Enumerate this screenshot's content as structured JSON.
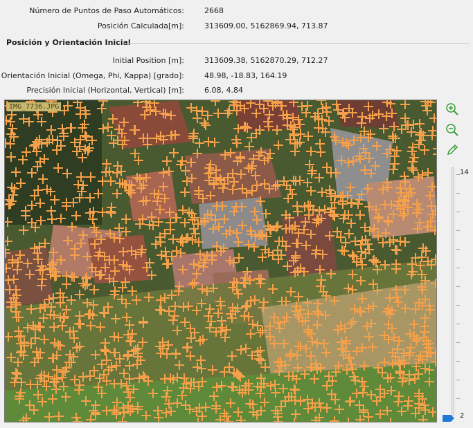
{
  "properties": {
    "auto_tie_points": {
      "label": "Número de Puntos de Paso Automáticos:",
      "value": "2668"
    },
    "computed_position": {
      "label": "Posición Calculada[m]:",
      "value": "313609.00, 5162869.94, 713.87"
    }
  },
  "section": {
    "title": "Posición y Orientación Inicial",
    "initial_position": {
      "label": "Initial Position [m]:",
      "value": "313609.38, 5162870.29, 712.27"
    },
    "initial_orientation": {
      "label": "Orientación Inicial (Omega, Phi, Kappa) [grado]:",
      "value": "48.98, -18.83, 164.19"
    },
    "initial_precision": {
      "label": "Precisión Inicial (Horizontal, Vertical) [m]:",
      "value": "6.08, 4.84"
    }
  },
  "image_view": {
    "filename": "IMG_7736.JPG",
    "marker_color": "#f5a04a",
    "label_bg": "#c7b870"
  },
  "toolbar": {
    "zoom_in_icon": "zoom-in-icon",
    "zoom_out_icon": "zoom-out-icon",
    "edit_icon": "pencil-icon",
    "accent_color": "#3a9a3a"
  },
  "zoom_slider": {
    "max_label": "14",
    "min_label": "2",
    "handle_color": "#1e7ad6"
  }
}
